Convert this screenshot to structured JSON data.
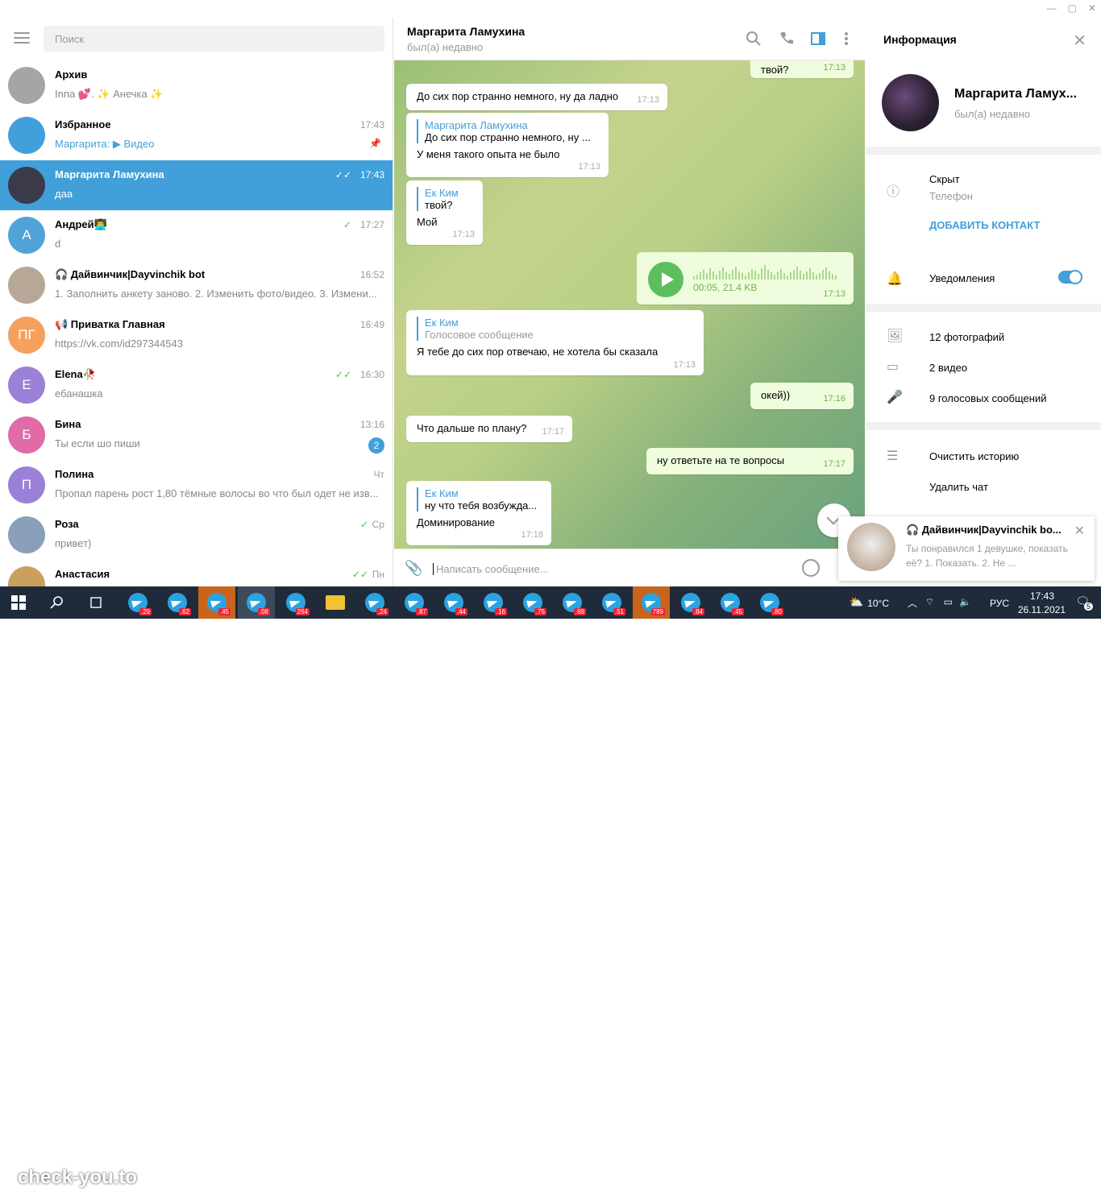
{
  "window": {
    "controls": [
      "—",
      "▢",
      "✕"
    ]
  },
  "left": {
    "search_placeholder": "Поиск",
    "chats": [
      {
        "name": "Архив",
        "msg": "Inna 💕. ✨ Анечка ✨",
        "time": "",
        "avatar": "",
        "color": "#a5a5a5"
      },
      {
        "name": "Избранное",
        "msg_prefix": "Маргарита:",
        "msg": "▶ Видео",
        "time": "17:43",
        "avatar": "",
        "color": "#419fd9",
        "pinned": true
      },
      {
        "name": "Маргарита Ламухина",
        "msg": "даа",
        "time": "17:43",
        "avatar": "",
        "color": "#3a3a4a",
        "checks": "✓✓"
      },
      {
        "name": "Андрей👨‍💻",
        "msg": "d",
        "time": "17:27",
        "avatar": "А",
        "color": "#4fa3d9",
        "checks": "✓"
      },
      {
        "name": "🎧 Дайвинчик|Dayvinchik bot",
        "msg": "1. Заполнить анкету заново. 2. Изменить фото/видео. 3. Измени...",
        "time": "16:52",
        "avatar": "",
        "color": "#b7a797"
      },
      {
        "name": "📢 Приватка Главная",
        "msg": "https://vk.com/id297344543",
        "time": "16:49",
        "avatar": "ПГ",
        "color": "#f6a05e"
      },
      {
        "name": "Elena🥀",
        "msg": "ебанашка",
        "time": "16:30",
        "avatar": "Е",
        "color": "#9a80d6",
        "checks": "✓✓"
      },
      {
        "name": "Бина",
        "msg": "Ты если шо пиши",
        "time": "13:16",
        "avatar": "Б",
        "color": "#e06ba6",
        "badge": "2"
      },
      {
        "name": "Полина",
        "msg": "Пропал парень рост 1,80 тёмные волосы во что был одет не изв...",
        "time": "Чт",
        "avatar": "П",
        "color": "#9a80d6"
      },
      {
        "name": "Роза",
        "msg": "привет)",
        "time": "Ср",
        "avatar": "",
        "color": "#8aa0b8",
        "checks": "✓"
      },
      {
        "name": "Анастасия",
        "msg": "",
        "time": "Пн",
        "avatar": "",
        "color": "#c9a060",
        "checks": "✓✓"
      }
    ]
  },
  "chat": {
    "title": "Маргарита Ламухина",
    "status": "был(а) недавно",
    "input_placeholder": "Написать сообщение...",
    "messages": [
      {
        "text": "твой?",
        "time": "17:13"
      },
      {
        "text": "До сих пор странно немного, ну да ладно",
        "time": "17:13"
      },
      {
        "quote_name": "Маргарита Ламухина",
        "quote_text": "До сих пор странно немного, ну ...",
        "text": "У меня такого опыта не было",
        "time": "17:13"
      },
      {
        "quote_name": "Ек Ким",
        "quote_text": "твой?",
        "text": "Мой",
        "time": "17:13"
      },
      {
        "voice_meta": "00:05, 21.4 KB",
        "time": "17:13"
      },
      {
        "quote_name": "Ек Ким",
        "quote_text": "Голосовое сообщение",
        "text": "Я тебе до сих пор отвечаю, не хотела бы сказала",
        "time": "17:13"
      },
      {
        "text": "окей))",
        "time": "17:16"
      },
      {
        "text": "Что дальше по плану?",
        "time": "17:17"
      },
      {
        "text": "ну ответьте на те вопросы",
        "time": "17:17"
      },
      {
        "quote_name": "Ек Ким",
        "quote_text": "ну что тебя возбужда...",
        "text": "Доминирование",
        "time": "17:18"
      }
    ]
  },
  "info": {
    "header": "Информация",
    "name": "Маргарита Ламух...",
    "status": "был(а) недавно",
    "phone_value": "Скрыт",
    "phone_label": "Телефон",
    "add_contact": "ДОБАВИТЬ КОНТАКТ",
    "notifications": "Уведомления",
    "notifications_on": true,
    "photos": "12 фотографий",
    "videos": "2 видео",
    "voices": "9 голосовых сообщений",
    "clear_history": "Очистить историю",
    "delete_chat": "Удалить чат"
  },
  "notification": {
    "title": "🎧 Дайвинчик|Dayvinchik bo...",
    "text": "Ты понравился 1 девушке, показать её? 1. Показать. 2. Не ..."
  },
  "taskbar": {
    "watermark": "check-you.to",
    "badges": [
      ".29",
      ".62",
      ".45",
      ".08",
      "264",
      ".24",
      ".87",
      ".44",
      ".16",
      ".75",
      ".69",
      ".51",
      "789",
      ".84",
      ".45",
      ".80"
    ],
    "temperature": "10°C",
    "language": "РУС",
    "time": "17:43",
    "date": "26.11.2021",
    "notif_count": "5"
  },
  "colors": {
    "accent": "#419fd9",
    "check_green": "#4dc34d"
  }
}
